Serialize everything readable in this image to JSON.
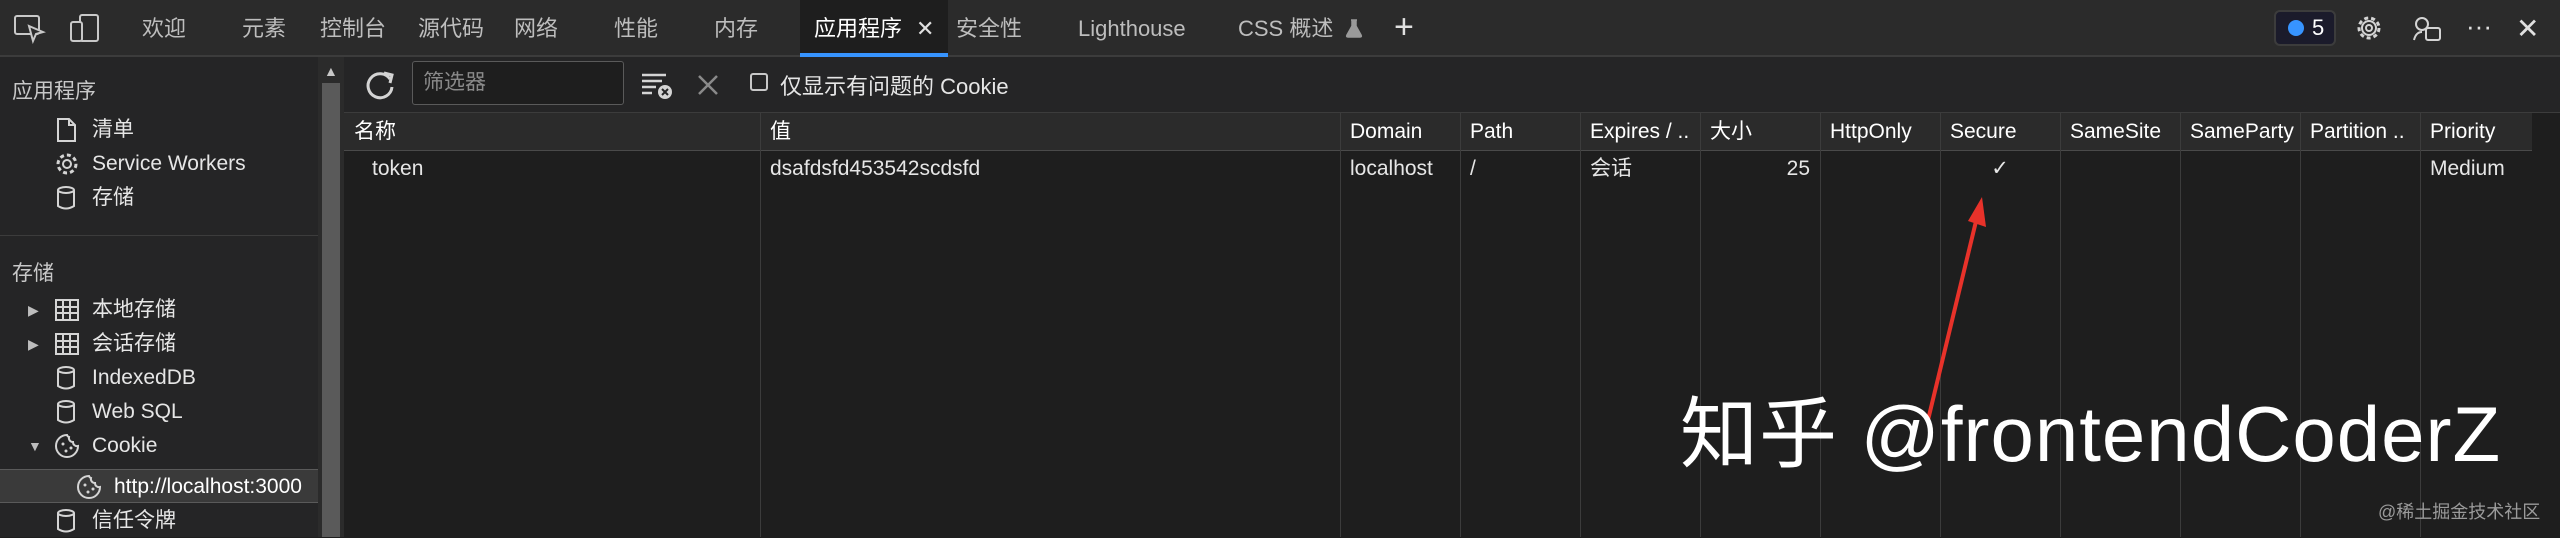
{
  "top_tabs": [
    {
      "label": "欢迎"
    },
    {
      "label": "元素"
    },
    {
      "label": "控制台"
    },
    {
      "label": "源代码"
    },
    {
      "label": "网络"
    },
    {
      "label": "性能"
    },
    {
      "label": "内存"
    },
    {
      "label": "应用程序",
      "active": true
    },
    {
      "label": "安全性"
    },
    {
      "label": "Lighthouse"
    },
    {
      "label": "CSS 概述"
    }
  ],
  "close_glyph": "✕",
  "add_glyph": "+",
  "issues_count": "5",
  "more_glyph": "···",
  "sidebar": {
    "app_section_title": "应用程序",
    "app_items": [
      "清单",
      "Service Workers",
      "存储"
    ],
    "storage_section_title": "存储",
    "storage_items": [
      "本地存储",
      "会话存储",
      "IndexedDB",
      "Web SQL",
      "Cookie"
    ],
    "cookie_child": "http://localhost:3000",
    "trust_tokens": "信任令牌"
  },
  "toolbar": {
    "filter_placeholder": "筛选器",
    "only_issues_label": "仅显示有问题的 Cookie"
  },
  "table": {
    "columns": [
      "名称",
      "值",
      "Domain",
      "Path",
      "Expires / ..",
      "大小",
      "HttpOnly",
      "Secure",
      "SameSite",
      "SameParty",
      "Partition ..",
      "Priority"
    ],
    "rows": [
      {
        "name": "token",
        "value": "dsafdsfd453542scdsfd",
        "domain": "localhost",
        "path": "/",
        "expires": "会话",
        "size": "25",
        "httponly": "",
        "secure": "✓",
        "samesite": "",
        "sameparty": "",
        "partition": "",
        "priority": "Medium"
      }
    ]
  },
  "watermark": "知乎 @frontendCoderZ",
  "watermark_small": "@稀土掘金技术社区",
  "colors": {
    "accent": "#3794ff",
    "arrow": "#e8322a",
    "background": "#1e1e1e"
  }
}
